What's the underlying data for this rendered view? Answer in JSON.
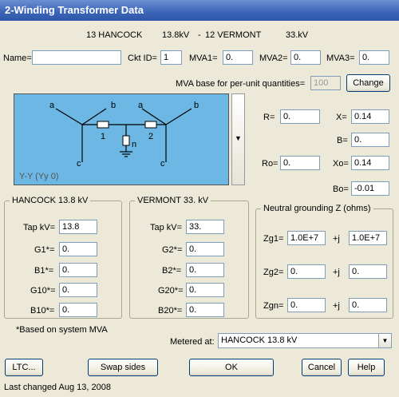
{
  "window": {
    "title": "2-Winding Transformer Data"
  },
  "header": {
    "from_bus": "13 HANCOCK",
    "from_kv": "13.8kV",
    "sep": "-",
    "to_bus": "12 VERMONT",
    "to_kv": "33.kV"
  },
  "row1": {
    "name_label": "Name=",
    "name_value": "",
    "ckt_label": "Ckt ID=",
    "ckt_value": "1",
    "mva1_label": "MVA1=",
    "mva1_value": "0.",
    "mva2_label": "MVA2=",
    "mva2_value": "0.",
    "mva3_label": "MVA3=",
    "mva3_value": "0."
  },
  "mva_base": {
    "label": "MVA base for per-unit quantities=",
    "value": "100",
    "change_label": "Change"
  },
  "diagram": {
    "a1": "a",
    "b1": "b",
    "c1": "c",
    "a2": "a",
    "b2": "b",
    "c2": "c",
    "n1": "1",
    "n2": "2",
    "n": "n",
    "connection": "Y-Y (Yy 0)"
  },
  "impedance": {
    "r_label": "R=",
    "r_value": "0.",
    "x_label": "X=",
    "x_value": "0.14",
    "b_label": "B=",
    "b_value": "0.",
    "ro_label": "Ro=",
    "ro_value": "0.",
    "xo_label": "Xo=",
    "xo_value": "0.14",
    "bo_label": "Bo=",
    "bo_value": "-0.01"
  },
  "side1": {
    "title": "HANCOCK    13.8 kV",
    "tap_label": "Tap kV=",
    "tap": "13.8",
    "g1_label": "G1*=",
    "g1": "0.",
    "b1_label": "B1*=",
    "b1": "0.",
    "g10_label": "G10*=",
    "g10": "0.",
    "b10_label": "B10*=",
    "b10": "0."
  },
  "side2": {
    "title": "VERMONT    33.  kV",
    "tap_label": "Tap kV=",
    "tap": "33.",
    "g2_label": "G2*=",
    "g2": "0.",
    "b2_label": "B2*=",
    "b2": "0.",
    "g20_label": "G20*=",
    "g20": "0.",
    "b20_label": "B20*=",
    "b20": "0."
  },
  "neutral": {
    "title": "Neutral grounding Z (ohms)",
    "zg1_label": "Zg1=",
    "zg1_re": "1.0E+7",
    "zg1_j": "+j",
    "zg1_im": "1.0E+7",
    "zg2_label": "Zg2=",
    "zg2_re": "0.",
    "zg2_j": "+j",
    "zg2_im": "0.",
    "zgn_label": "Zgn=",
    "zgn_re": "0.",
    "zgn_j": "+j",
    "zgn_im": "0."
  },
  "footnote": "*Based on system MVA",
  "metered": {
    "label": "Metered at:",
    "value": "HANCOCK      13.8 kV"
  },
  "buttons": {
    "ltc": "LTC...",
    "swap": "Swap sides",
    "ok": "OK",
    "cancel": "Cancel",
    "help": "Help"
  },
  "status": "Last changed Aug 13, 2008",
  "colors": {
    "diagram_bg": "#6cb7e4",
    "title_bar": "#3a64b8"
  }
}
